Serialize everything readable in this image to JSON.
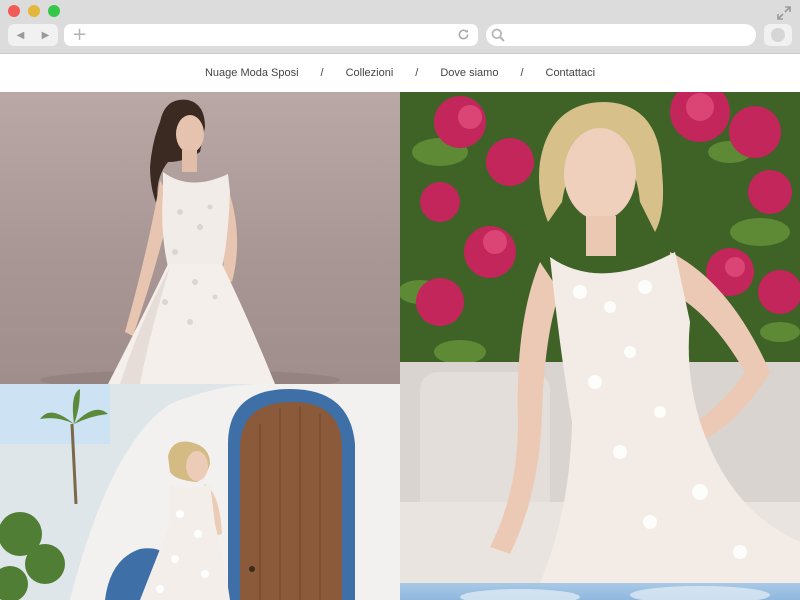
{
  "browser": {
    "back_icon": "back-arrow-icon",
    "forward_icon": "forward-arrow-icon",
    "new_tab_icon": "plus-icon",
    "reload_icon": "reload-icon",
    "search_icon": "search-icon",
    "url": "",
    "search_placeholder": ""
  },
  "nav": {
    "items": [
      {
        "label": "Nuage Moda Sposi"
      },
      {
        "label": "Collezioni"
      },
      {
        "label": "Dove siamo"
      },
      {
        "label": "Contattaci"
      }
    ],
    "separator": "/"
  },
  "gallery": [
    {
      "subject": "bride-lace-gown-studio"
    },
    {
      "subject": "bride-among-hydrangeas"
    },
    {
      "subject": "bride-by-arched-door"
    },
    {
      "subject": "sky-photo-partial"
    }
  ],
  "colors": {
    "chrome": "#dcdcdc",
    "hydrangea": "#c2265a",
    "leaves": "#3b5a24",
    "arch_blue": "#3f6fa7"
  }
}
